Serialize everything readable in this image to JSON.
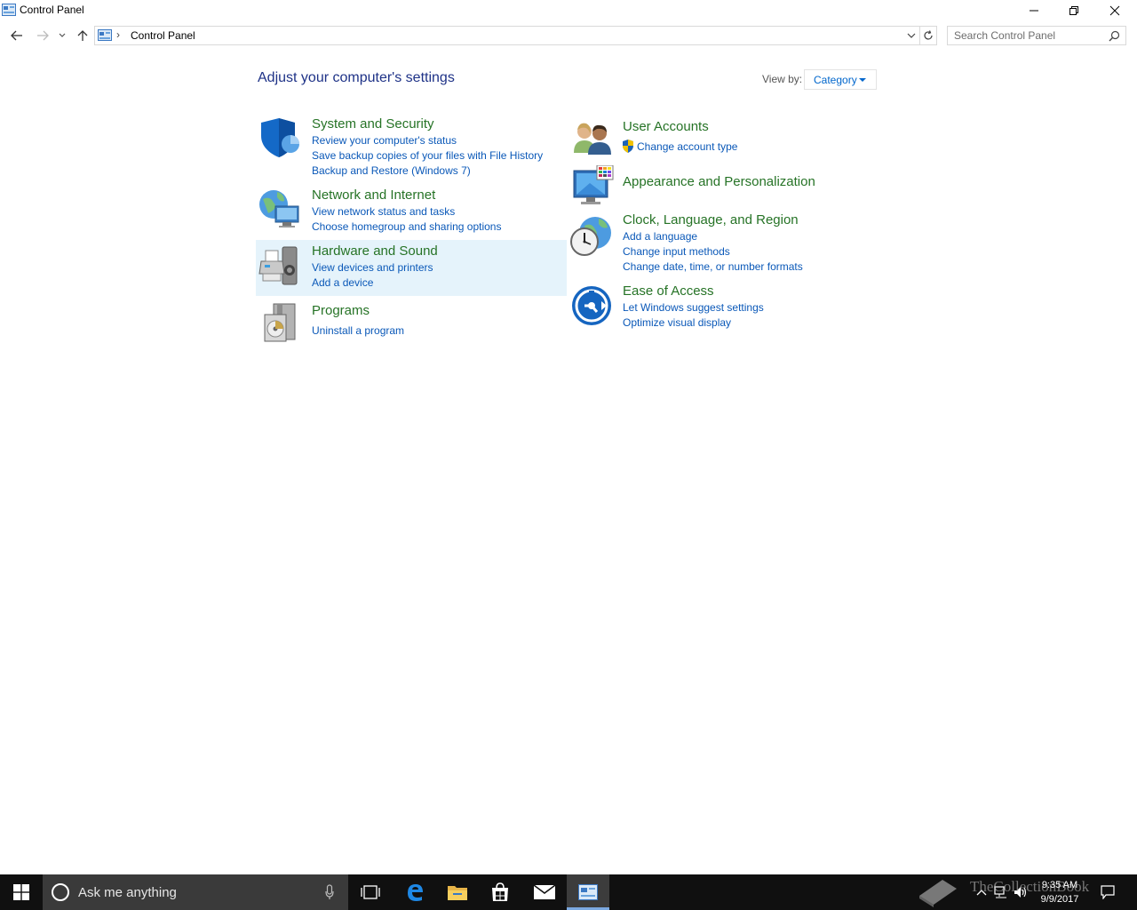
{
  "window": {
    "title": "Control Panel"
  },
  "address": {
    "crumb": "Control Panel",
    "search_placeholder": "Search Control Panel"
  },
  "main": {
    "heading": "Adjust your computer's settings",
    "view_by_label": "View by:",
    "view_by_value": "Category"
  },
  "categories": [
    {
      "title": "System and Security",
      "icon": "shield-icon",
      "links": [
        "Review your computer's status",
        "Save backup copies of your files with File History",
        "Backup and Restore (Windows 7)"
      ]
    },
    {
      "title": "Network and Internet",
      "icon": "network-icon",
      "links": [
        "View network status and tasks",
        "Choose homegroup and sharing options"
      ]
    },
    {
      "title": "Hardware and Sound",
      "icon": "printer-icon",
      "links": [
        "View devices and printers",
        "Add a device"
      ]
    },
    {
      "title": "Programs",
      "icon": "programs-icon",
      "links": [
        "Uninstall a program"
      ]
    },
    {
      "title": "User Accounts",
      "icon": "users-icon",
      "links": [
        "Change account type"
      ]
    },
    {
      "title": "Appearance and Personalization",
      "icon": "monitor-icon",
      "links": []
    },
    {
      "title": "Clock, Language, and Region",
      "icon": "clock-globe-icon",
      "links": [
        "Add a language",
        "Change input methods",
        "Change date, time, or number formats"
      ]
    },
    {
      "title": "Ease of Access",
      "icon": "ease-of-access-icon",
      "links": [
        "Let Windows suggest settings",
        "Optimize visual display"
      ]
    }
  ],
  "taskbar": {
    "cortana_text": "Ask me anything",
    "time": "9:35 AM",
    "date": "9/9/2017",
    "watermark": "TheCollectionBook"
  },
  "colors": {
    "category_title": "#267326",
    "link": "#0a58b8",
    "heading": "#1e3287",
    "hover": "#e5f3fb"
  }
}
